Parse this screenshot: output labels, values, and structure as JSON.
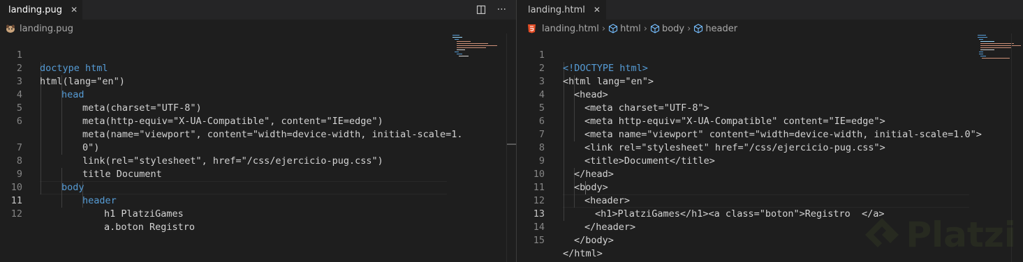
{
  "left_editor": {
    "tab": {
      "label": "landing.pug",
      "close_glyph": "✕",
      "file_icon": "pug-icon"
    },
    "actions": {
      "split": "split-editor-icon",
      "more_glyph": "···"
    },
    "breadcrumb": {
      "file": "landing.pug"
    },
    "line_numbers": [
      "1",
      "2",
      "3",
      "4",
      "5",
      "6",
      "",
      "7",
      "8",
      "9",
      "10",
      "11",
      "12"
    ],
    "lines": [
      "doctype html",
      "html(lang=\"en\")",
      "head",
      "meta(charset=\"UTF-8\")",
      "meta(http-equiv=\"X-UA-Compatible\", content=\"IE=edge\")",
      "meta(name=\"viewport\", content=\"width=device-width, initial-scale=1.",
      "0\")",
      "link(rel=\"stylesheet\", href=\"/css/ejercicio-pug.css\")",
      "title Document",
      "body",
      "header",
      "h1 PlatziGames",
      "a.boton Registro"
    ],
    "active_line": "11"
  },
  "right_editor": {
    "tab": {
      "label": "landing.html",
      "close_glyph": "✕",
      "file_icon": "html5-icon"
    },
    "breadcrumb": {
      "file": "landing.html",
      "items": [
        "html",
        "body",
        "header"
      ]
    },
    "line_numbers": [
      "1",
      "2",
      "3",
      "4",
      "5",
      "6",
      "7",
      "8",
      "9",
      "10",
      "11",
      "12",
      "13",
      "14",
      "15"
    ],
    "lines": [
      "<!DOCTYPE html>",
      "<html lang=\"en\">",
      "<head>",
      "<meta charset=\"UTF-8\">",
      "<meta http-equiv=\"X-UA-Compatible\" content=\"IE=edge\">",
      "<meta name=\"viewport\" content=\"width=device-width, initial-scale=1.0\">",
      "<link rel=\"stylesheet\" href=\"/css/ejercicio-pug.css\">",
      "<title>Document</title>",
      "</head>",
      "<body>",
      "<header>",
      "<h1>PlatziGames</h1><a class=\"boton\">Registro  </a>",
      "</header>",
      "</body>",
      "</html>"
    ],
    "active_line": "13"
  },
  "watermark": {
    "text": "Platzi"
  },
  "colors": {
    "editor_bg": "#1e1e1e",
    "tab_bg": "#252526",
    "keyword": "#569cd6",
    "attribute": "#9cdcfe",
    "string": "#ce9178",
    "bracket": "#808080",
    "text": "#d4d4d4",
    "platzi_green": "#98ca3f"
  }
}
